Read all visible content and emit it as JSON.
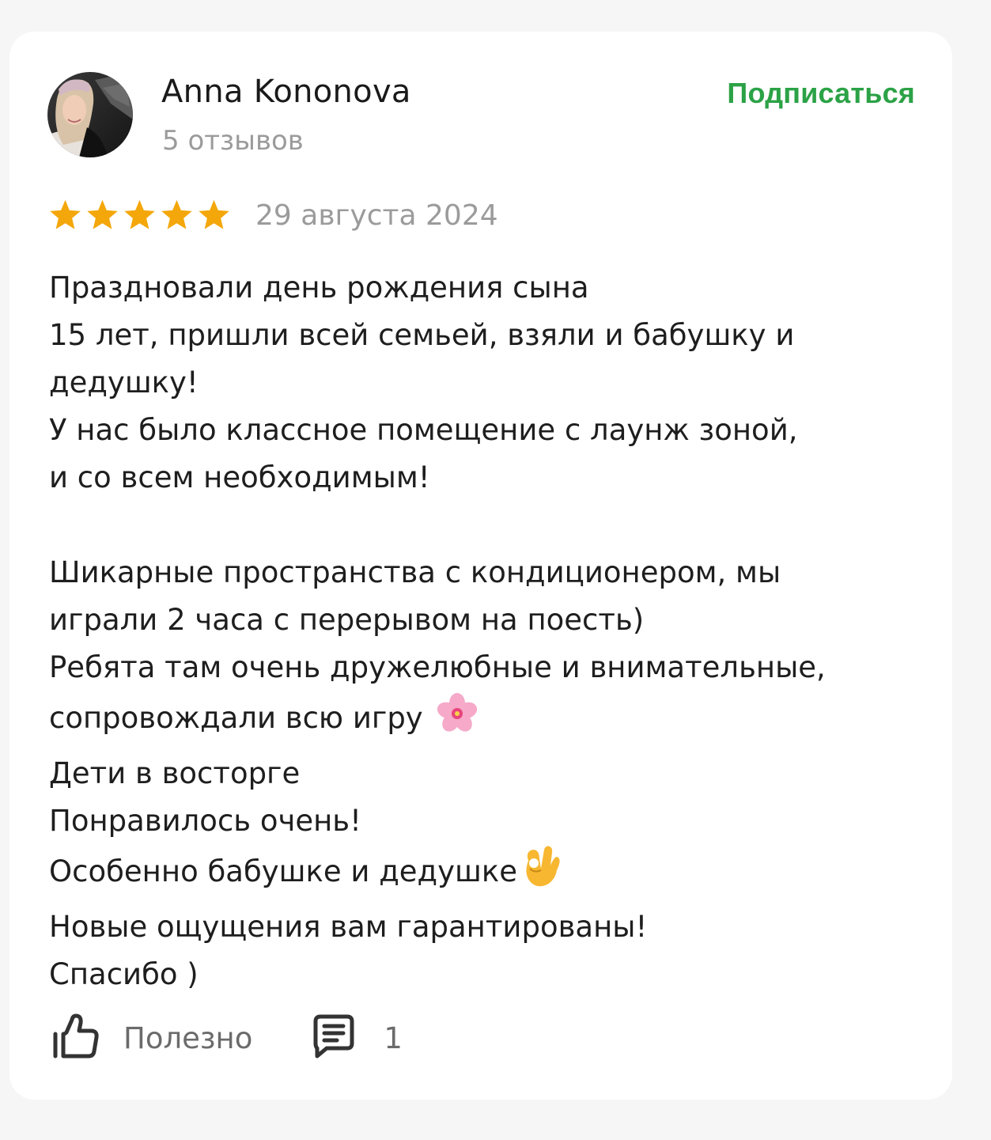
{
  "author": {
    "name": "Anna Kononova",
    "reviews_count": "5 отзывов",
    "avatar": "avatar-photo"
  },
  "subscribe_label": "Подписаться",
  "rating": {
    "stars": 5,
    "max": 5,
    "color": "#f4a70a"
  },
  "date": "29 августа 2024",
  "review_lines": [
    "Праздновали день рождения сына",
    "15 лет, пришли всей семьей, взяли и бабушку и",
    "дедушку!",
    "У нас было классное помещение с лаунж зоной,",
    "и со всем необходимым!",
    "",
    "Шикарные пространства с кондиционером, мы",
    "играли 2 часа с перерывом на поесть)",
    "Ребята там очень дружелюбные и внимательные,",
    "сопровождали всю игру",
    "Дети в восторге",
    "Понравилось очень!",
    "Особенно бабушке и дедушке",
    "Новые ощущения вам гарантированы!",
    "Спасибо )"
  ],
  "emojis": {
    "line_9": "cherry-blossom-emoji",
    "line_12": "ok-hand-emoji"
  },
  "footer": {
    "useful_label": "Полезно",
    "comments_count": "1"
  },
  "colors": {
    "accent_green": "#2ba246",
    "star_gold": "#f4a70a",
    "muted_text": "#9b9b9b"
  }
}
